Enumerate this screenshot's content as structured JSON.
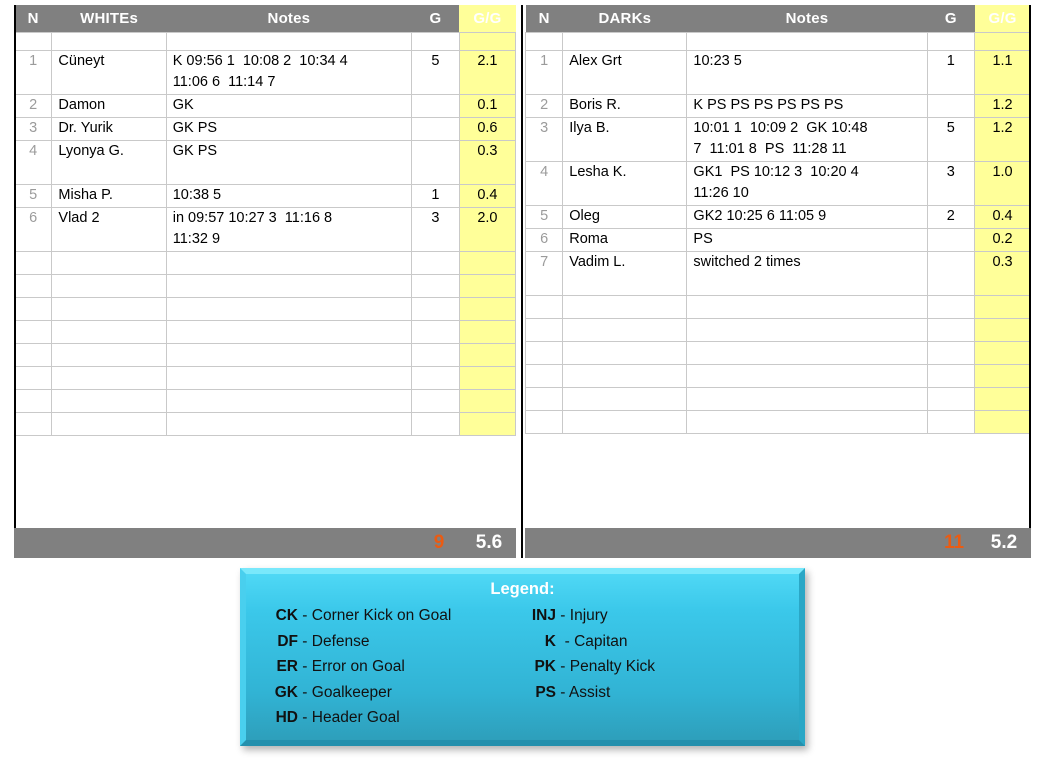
{
  "tables": [
    {
      "id": "whites",
      "headers": [
        "N",
        "WHITEs",
        "Notes",
        "G",
        "G/G"
      ],
      "rows": [
        {
          "n": "1",
          "name": "Cüneyt",
          "notes": "K 09:56 1  10:08 2  10:34 4\n11:06 6  11:14 7",
          "g": "5",
          "gg": "2.1"
        },
        {
          "n": "2",
          "name": "Damon",
          "notes": "GK",
          "g": "",
          "gg": "0.1"
        },
        {
          "n": "3",
          "name": "Dr. Yurik",
          "notes": "GK  PS",
          "g": "",
          "gg": "0.6"
        },
        {
          "n": "4",
          "name": "Lyonya G.",
          "notes": "GK  PS",
          "g": "",
          "gg": "0.3"
        },
        {
          "n": "5",
          "name": "Misha P.",
          "notes": "10:38 5",
          "g": "1",
          "gg": "0.4"
        },
        {
          "n": "6",
          "name": "Vlad 2",
          "notes": "in 09:57 10:27 3  11:16 8\n11:32 9",
          "g": "3",
          "gg": "2.0"
        },
        {
          "n": "",
          "name": "",
          "notes": "",
          "g": "",
          "gg": ""
        },
        {
          "n": "",
          "name": "",
          "notes": "",
          "g": "",
          "gg": ""
        },
        {
          "n": "",
          "name": "",
          "notes": "",
          "g": "",
          "gg": ""
        },
        {
          "n": "",
          "name": "",
          "notes": "",
          "g": "",
          "gg": ""
        },
        {
          "n": "",
          "name": "",
          "notes": "",
          "g": "",
          "gg": ""
        },
        {
          "n": "",
          "name": "",
          "notes": "",
          "g": "",
          "gg": ""
        },
        {
          "n": "",
          "name": "",
          "notes": "",
          "g": "",
          "gg": ""
        },
        {
          "n": "",
          "name": "",
          "notes": "",
          "g": "",
          "gg": ""
        }
      ],
      "totals": {
        "goals": "9",
        "gg": "5.6"
      }
    },
    {
      "id": "darks",
      "headers": [
        "N",
        "DARKs",
        "Notes",
        "G",
        "G/G"
      ],
      "rows": [
        {
          "n": "1",
          "name": "Alex Grt",
          "notes": "10:23 5",
          "g": "1",
          "gg": "1.1"
        },
        {
          "n": "2",
          "name": "Boris R.",
          "notes": "K  PS PS  PS  PS PS  PS",
          "g": "",
          "gg": "1.2"
        },
        {
          "n": "3",
          "name": "Ilya B.",
          "notes": "10:01 1  10:09 2  GK 10:48\n7  11:01 8  PS  11:28 11",
          "g": "5",
          "gg": "1.2"
        },
        {
          "n": "4",
          "name": "Lesha K.",
          "notes": "GK1  PS 10:12 3  10:20 4\n11:26 10",
          "g": "3",
          "gg": "1.0"
        },
        {
          "n": "5",
          "name": "Oleg",
          "notes": "GK2 10:25 6  11:05 9",
          "g": "2",
          "gg": "0.4"
        },
        {
          "n": "6",
          "name": "Roma",
          "notes": "PS",
          "g": "",
          "gg": "0.2"
        },
        {
          "n": "7",
          "name": "Vadim L.",
          "notes": "switched 2 times",
          "g": "",
          "gg": "0.3"
        },
        {
          "n": "",
          "name": "",
          "notes": "",
          "g": "",
          "gg": ""
        },
        {
          "n": "",
          "name": "",
          "notes": "",
          "g": "",
          "gg": ""
        },
        {
          "n": "",
          "name": "",
          "notes": "",
          "g": "",
          "gg": ""
        },
        {
          "n": "",
          "name": "",
          "notes": "",
          "g": "",
          "gg": ""
        },
        {
          "n": "",
          "name": "",
          "notes": "",
          "g": "",
          "gg": ""
        },
        {
          "n": "",
          "name": "",
          "notes": "",
          "g": "",
          "gg": ""
        }
      ],
      "totals": {
        "goals": "11",
        "gg": "5.2"
      }
    }
  ],
  "legend": {
    "title": "Legend:",
    "columns": [
      [
        {
          "abbr": "CK",
          "text": " - Corner Kick on Goal"
        },
        {
          "abbr": "DF",
          "text": " - Defense"
        },
        {
          "abbr": "ER",
          "text": " - Error on Goal"
        },
        {
          "abbr": "GK",
          "text": " - Goalkeeper"
        },
        {
          "abbr": "HD",
          "text": " - Header Goal"
        }
      ],
      [
        {
          "abbr": "INJ",
          "text": " - Injury"
        },
        {
          "abbr": "K",
          "text": "  - Capitan"
        },
        {
          "abbr": "PK",
          "text": " - Penalty Kick"
        },
        {
          "abbr": "PS",
          "text": " - Assist"
        }
      ]
    ]
  },
  "colors": {
    "header_bar": "#808080",
    "gg_highlight": "#ffff99",
    "goals_total": "#ea5b12",
    "legend_top": "#4fd8f5",
    "legend_bottom": "#2e9fbb"
  }
}
